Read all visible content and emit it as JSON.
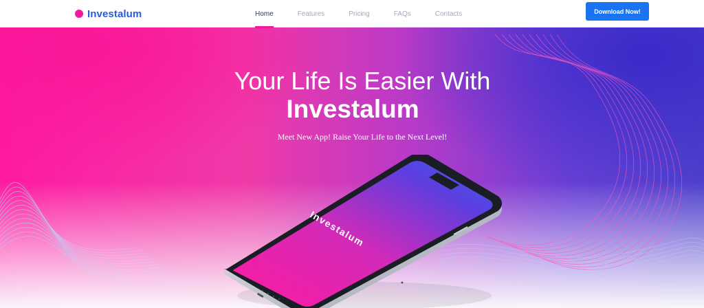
{
  "header": {
    "brand_name": "Investalum",
    "nav": [
      {
        "label": "Home",
        "active": true
      },
      {
        "label": "Features",
        "active": false
      },
      {
        "label": "Pricing",
        "active": false
      },
      {
        "label": "FAQs",
        "active": false
      },
      {
        "label": "Contacts",
        "active": false
      }
    ],
    "download_label": "Download Now!"
  },
  "hero": {
    "title_line1": "Your Life Is Easier With",
    "title_line2": "Investalum",
    "subtitle": "Meet New App! Raise Your Life to the Next Level!",
    "phone_screen_text": "Investalum"
  },
  "colors": {
    "brand_pink": "#f2199d",
    "brand_blue": "#2a5bd7",
    "button_blue": "#1a73f0",
    "hero_gradient_left": "#ff1aa0",
    "hero_gradient_right": "#4f42cc"
  }
}
